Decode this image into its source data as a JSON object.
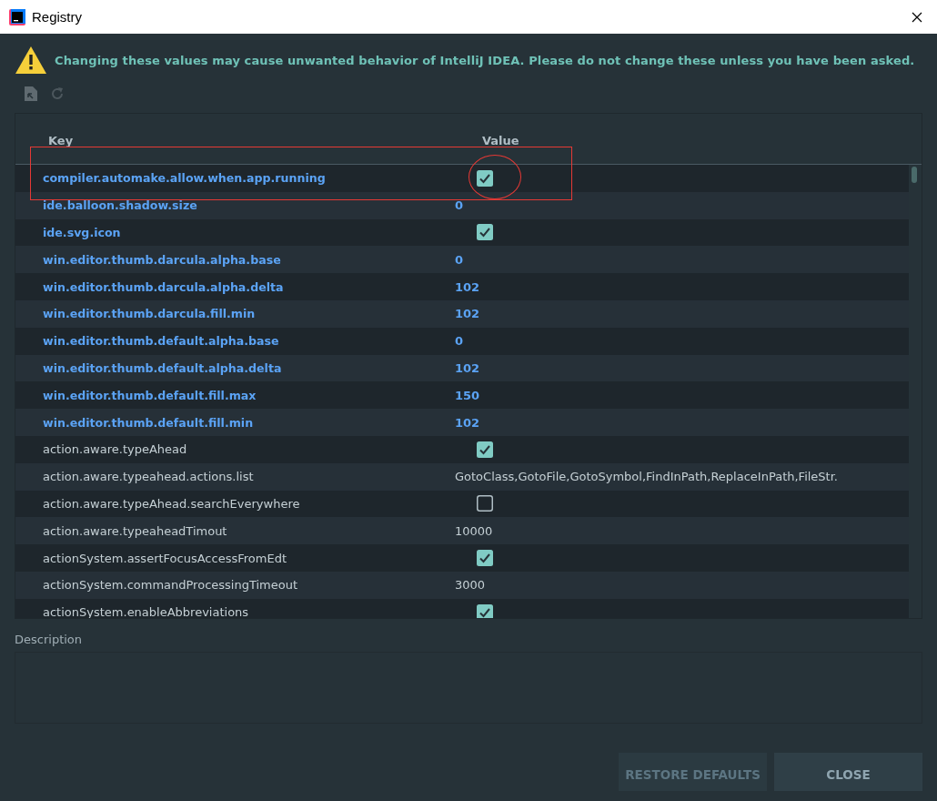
{
  "window": {
    "title": "Registry"
  },
  "warning": "Changing these values may cause unwanted behavior of IntelliJ IDEA. Please do not change these unless you have been asked.",
  "table": {
    "columns": [
      "Key",
      "Value"
    ],
    "rows": [
      {
        "key": "compiler.automake.allow.when.app.running",
        "kind": "check",
        "checked": true,
        "modified": true,
        "highlighted": true
      },
      {
        "key": "ide.balloon.shadow.size",
        "kind": "text",
        "value": "0",
        "modified": true,
        "highlighted": false
      },
      {
        "key": "ide.svg.icon",
        "kind": "check",
        "checked": true,
        "modified": true,
        "highlighted": false
      },
      {
        "key": "win.editor.thumb.darcula.alpha.base",
        "kind": "text",
        "value": "0",
        "modified": true,
        "highlighted": false
      },
      {
        "key": "win.editor.thumb.darcula.alpha.delta",
        "kind": "text",
        "value": "102",
        "modified": true,
        "highlighted": false
      },
      {
        "key": "win.editor.thumb.darcula.fill.min",
        "kind": "text",
        "value": "102",
        "modified": true,
        "highlighted": false
      },
      {
        "key": "win.editor.thumb.default.alpha.base",
        "kind": "text",
        "value": "0",
        "modified": true,
        "highlighted": false
      },
      {
        "key": "win.editor.thumb.default.alpha.delta",
        "kind": "text",
        "value": "102",
        "modified": true,
        "highlighted": false
      },
      {
        "key": "win.editor.thumb.default.fill.max",
        "kind": "text",
        "value": "150",
        "modified": true,
        "highlighted": false
      },
      {
        "key": "win.editor.thumb.default.fill.min",
        "kind": "text",
        "value": "102",
        "modified": true,
        "highlighted": false
      },
      {
        "key": "action.aware.typeAhead",
        "kind": "check",
        "checked": true,
        "modified": false,
        "highlighted": false
      },
      {
        "key": "action.aware.typeahead.actions.list",
        "kind": "text",
        "value": "GotoClass,GotoFile,GotoSymbol,FindInPath,ReplaceInPath,FileStr.",
        "modified": false,
        "highlighted": false
      },
      {
        "key": "action.aware.typeAhead.searchEverywhere",
        "kind": "check",
        "checked": false,
        "modified": false,
        "highlighted": false
      },
      {
        "key": "action.aware.typeaheadTimout",
        "kind": "text",
        "value": "10000",
        "modified": false,
        "highlighted": false
      },
      {
        "key": "actionSystem.assertFocusAccessFromEdt",
        "kind": "check",
        "checked": true,
        "modified": false,
        "highlighted": false
      },
      {
        "key": "actionSystem.commandProcessingTimeout",
        "kind": "text",
        "value": "3000",
        "modified": false,
        "highlighted": false
      },
      {
        "key": "actionSystem.enableAbbreviations",
        "kind": "check",
        "checked": true,
        "modified": false,
        "highlighted": false
      }
    ]
  },
  "description": {
    "label": "Description"
  },
  "buttons": [
    {
      "label": "RESTORE DEFAULTS",
      "disabled": true
    },
    {
      "label": "CLOSE",
      "disabled": false
    }
  ]
}
